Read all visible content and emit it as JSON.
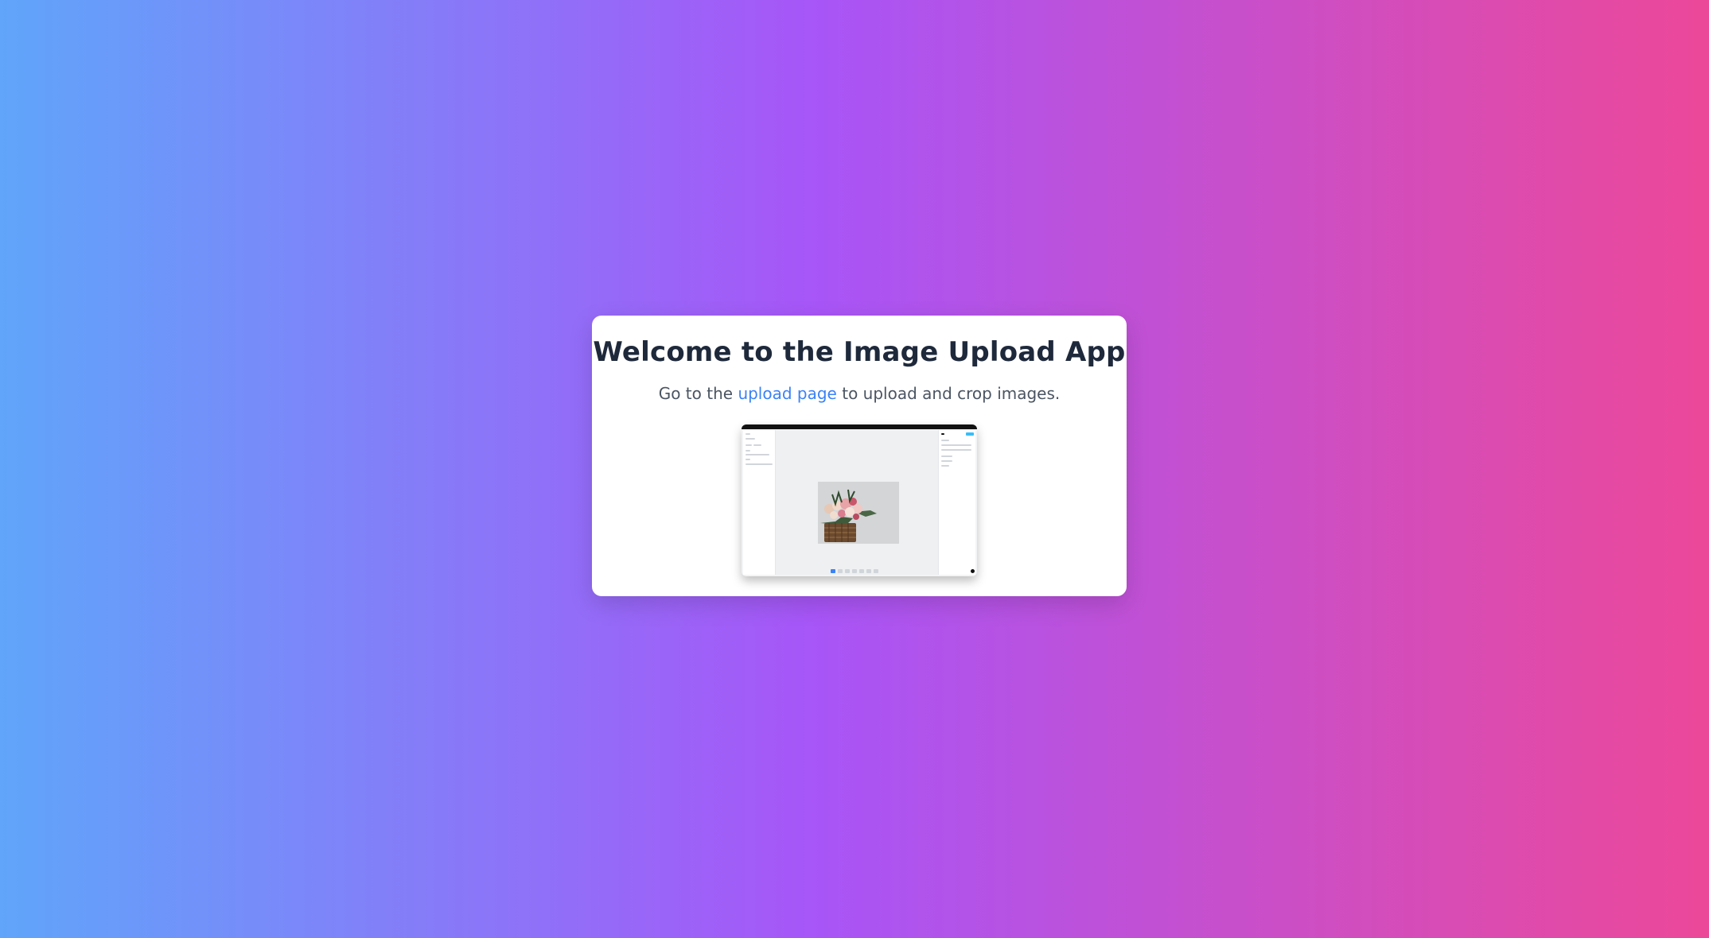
{
  "card": {
    "title": "Welcome to the Image Upload App",
    "subtitle_prefix": "Go to the ",
    "subtitle_link": "upload page",
    "subtitle_suffix": " to upload and crop images."
  },
  "colors": {
    "gradient_start": "#60a5fa",
    "gradient_mid": "#a855f7",
    "gradient_end": "#ec4899",
    "link": "#3b82f6",
    "title": "#1e293b"
  },
  "preview": {
    "icon": "app-screenshot-image"
  }
}
